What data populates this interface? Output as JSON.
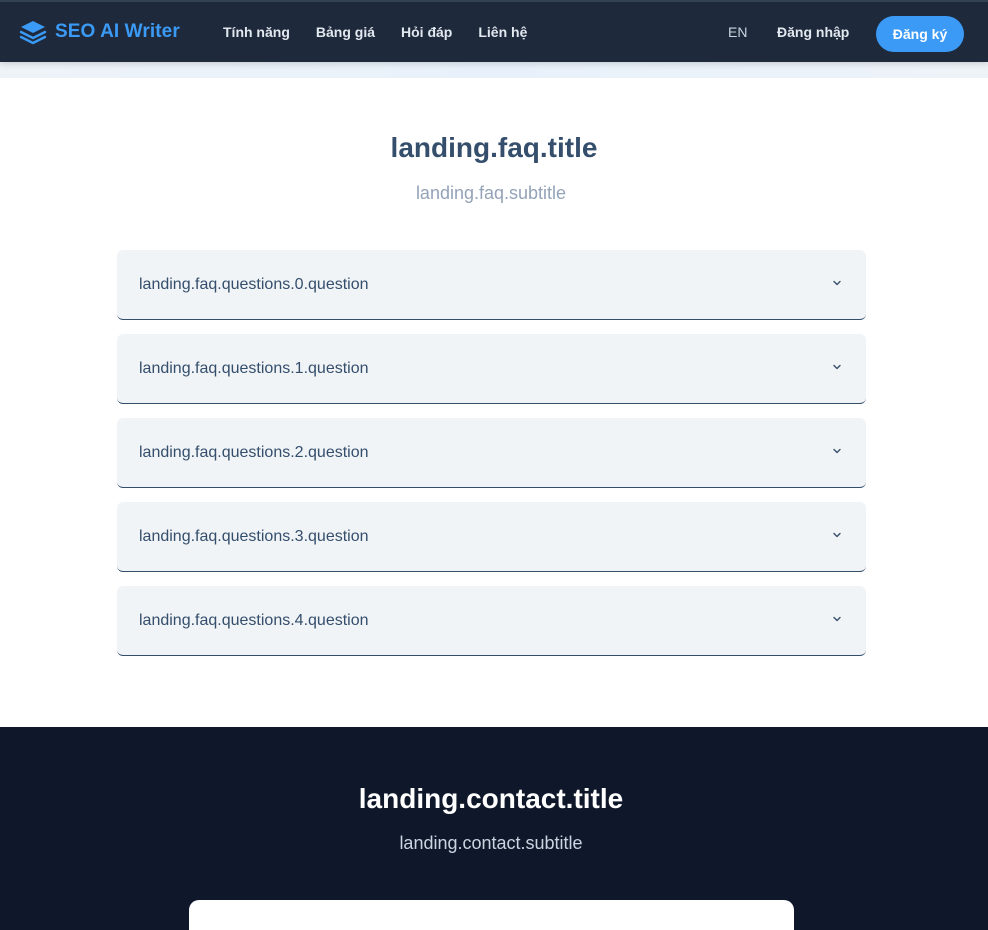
{
  "header": {
    "brand": "SEO AI Writer",
    "nav": [
      "Tính năng",
      "Bảng giá",
      "Hỏi đáp",
      "Liên hệ"
    ],
    "lang": "EN",
    "login": "Đăng nhập",
    "signup": "Đăng ký"
  },
  "faq": {
    "title": "landing.faq.title",
    "subtitle": "landing.faq.subtitle",
    "questions": [
      "landing.faq.questions.0.question",
      "landing.faq.questions.1.question",
      "landing.faq.questions.2.question",
      "landing.faq.questions.3.question",
      "landing.faq.questions.4.question"
    ]
  },
  "contact": {
    "title": "landing.contact.title",
    "subtitle": "landing.contact.subtitle"
  },
  "icons": {
    "logo": "layers-icon",
    "chevron": "chevron-down-icon"
  },
  "colors": {
    "header_bg": "#1e293b",
    "accent": "#3b9af5",
    "faq_text": "#344e6c",
    "contact_bg": "#0f172a"
  }
}
